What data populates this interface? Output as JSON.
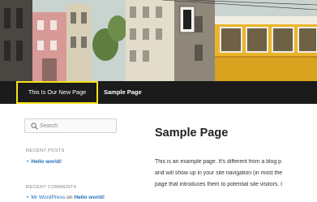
{
  "nav": {
    "items": [
      {
        "label": "This Is Our New Page",
        "highlighted": true
      },
      {
        "label": "Sample Page",
        "highlighted": false
      }
    ],
    "highlight_color": "#f5e21a",
    "bar_color": "#1b1b1b"
  },
  "search": {
    "placeholder": "Search",
    "icon": "search-icon"
  },
  "sidebar": {
    "recent_posts": {
      "title": "RECENT POSTS",
      "items": [
        "Hello world!"
      ]
    },
    "recent_comments": {
      "title": "RECENT COMMENTS",
      "items": [
        {
          "author": "Mr WordPress",
          "on": "on",
          "post": "Hello world!"
        }
      ]
    }
  },
  "content": {
    "title": "Sample Page",
    "lines": [
      "This is an example page. It's different from a blog p",
      "and will show up in your site navigation (in most the",
      "page that introduces them to potential site visitors. I"
    ]
  },
  "colors": {
    "link": "#1f6fb5",
    "accent_highlight": "#f5e21a"
  }
}
